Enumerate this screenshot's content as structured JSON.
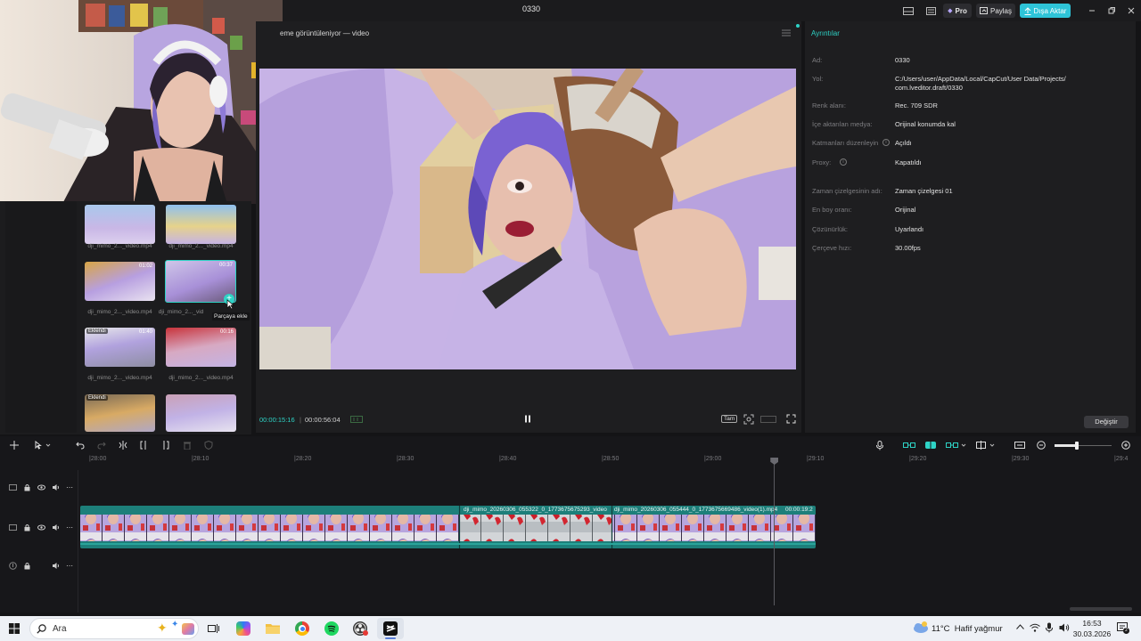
{
  "window": {
    "title": "0330"
  },
  "titlebar": {
    "pro_label": "Pro",
    "share_label": "Paylaş",
    "export_label": "Dışa Aktar"
  },
  "preview": {
    "header": "eme görüntüleniyor — video",
    "time_current": "00:00:15:16",
    "time_total": "00:00:56:04",
    "ratio_label": "Tam"
  },
  "media": {
    "items": [
      {
        "label": "dji_mimo_2..._video.mp4",
        "duration": "",
        "added": ""
      },
      {
        "label": "dji_mimo_2..._video.mp4",
        "duration": "",
        "added": ""
      },
      {
        "label": "dji_mimo_2..._video.mp4",
        "duration": "01:02",
        "added": ""
      },
      {
        "label": "dji_mimo_2..._vid",
        "duration": "00:37",
        "added": ""
      },
      {
        "label": "dji_mimo_2..._video.mp4",
        "duration": "01:40",
        "added": "Eklendi"
      },
      {
        "label": "dji_mimo_2..._video.mp4",
        "duration": "00:16",
        "added": ""
      },
      {
        "label": "",
        "duration": "",
        "added": "Eklendi"
      },
      {
        "label": "",
        "duration": "",
        "added": ""
      }
    ],
    "tooltip": "Parçaya ekle"
  },
  "details": {
    "title": "Ayrıntılar",
    "rows": [
      {
        "key": "Ad:",
        "value": "0330"
      },
      {
        "key": "Yol:",
        "value": "C:/Users/user/AppData/Local/CapCut/User Data/Projects/",
        "value2": "com.lveditor.draft/0330"
      },
      {
        "key": "Renk alanı:",
        "value": "Rec. 709 SDR"
      },
      {
        "key": "İçe aktarılan medya:",
        "value": "Orijinal konumda kal"
      },
      {
        "key": "Katmanları düzenleyin",
        "value": "Açıldı"
      },
      {
        "key": "Proxy:",
        "value": "Kapatıldı"
      },
      {
        "key": "Zaman çizelgesinin adı:",
        "value": "Zaman çizelgesi 01"
      },
      {
        "key": "En boy oranı:",
        "value": "Orijinal"
      },
      {
        "key": "Çözünürlük:",
        "value": "Uyarlandı"
      },
      {
        "key": "Çerçeve hızı:",
        "value": "30.00fps"
      }
    ],
    "modify_button": "Değiştir"
  },
  "timeline": {
    "ruler": [
      "|28:00",
      "|28:10",
      "|28:20",
      "|28:30",
      "|28:40",
      "|28:50",
      "|29:00",
      "|29:10",
      "|29:20",
      "|29:30",
      "|29:4"
    ],
    "clips": [
      {
        "label": ""
      },
      {
        "label": "dji_mimo_20260306_055322_0_1773675675293_video"
      },
      {
        "label": "dji_mimo_20260306_055444_0_1773675669486_video(1).mp4"
      }
    ],
    "clip_end_time": "00:00:19:2",
    "playhead_fraction": 0.654
  },
  "taskbar": {
    "search_placeholder": "Ara",
    "weather": "11°C  Hafif yağmur",
    "time": "16:53",
    "date": "30.03.2026"
  },
  "colors": {
    "accent": "#2ed3c6",
    "clip_teal": "#1d7f7a",
    "export_bg": "#2ec4d8",
    "lilac": "#c9b5e6"
  }
}
